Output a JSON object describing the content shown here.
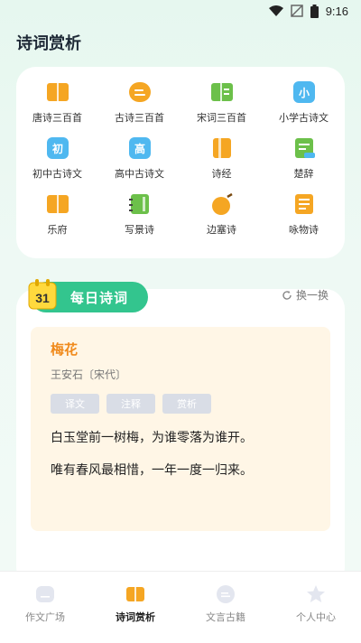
{
  "status_bar": {
    "time": "9:16"
  },
  "page": {
    "title": "诗词赏析"
  },
  "categories": [
    {
      "label": "唐诗三百首",
      "icon": "book-icon",
      "color": "#f5a623"
    },
    {
      "label": "古诗三百首",
      "icon": "chat-icon",
      "color": "#f5a623"
    },
    {
      "label": "宋词三百首",
      "icon": "book-open-icon",
      "color": "#6cc04a"
    },
    {
      "label": "小学古诗文",
      "icon": "primary-badge-icon",
      "glyph": "小",
      "color": "#4fb8f0"
    },
    {
      "label": "初中古诗文",
      "icon": "junior-badge-icon",
      "glyph": "初",
      "color": "#4fb8f0"
    },
    {
      "label": "高中古诗文",
      "icon": "senior-badge-icon",
      "glyph": "高",
      "color": "#4fb8f0"
    },
    {
      "label": "诗经",
      "icon": "scroll-book-icon",
      "color": "#f5a623"
    },
    {
      "label": "楚辞",
      "icon": "document-icon",
      "color": "#6cc04a"
    },
    {
      "label": "乐府",
      "icon": "book-icon",
      "color": "#f5a623"
    },
    {
      "label": "写景诗",
      "icon": "notebook-icon",
      "color": "#6cc04a"
    },
    {
      "label": "边塞诗",
      "icon": "leaf-icon",
      "color": "#f5a623"
    },
    {
      "label": "咏物诗",
      "icon": "list-document-icon",
      "color": "#f5a623"
    }
  ],
  "daily": {
    "title": "每日诗词",
    "calendar_day": "31",
    "refresh_label": "换一换",
    "poem": {
      "title": "梅花",
      "author": "王安石〔宋代〕",
      "tags": [
        "译文",
        "注释",
        "赏析"
      ],
      "lines": [
        "白玉堂前一树梅，为谁零落为谁开。",
        "唯有春风最相惜，一年一度一归来。"
      ]
    }
  },
  "bottom_nav": [
    {
      "label": "作文广场",
      "icon": "square-chat-icon",
      "active": false
    },
    {
      "label": "诗词赏析",
      "icon": "book-icon",
      "active": true
    },
    {
      "label": "文言古籍",
      "icon": "bubble-icon",
      "active": false
    },
    {
      "label": "个人中心",
      "icon": "star-icon",
      "active": false
    }
  ],
  "colors": {
    "accent_green": "#33c58e",
    "accent_orange": "#f08a1c",
    "poem_bg": "#fff6e6"
  }
}
